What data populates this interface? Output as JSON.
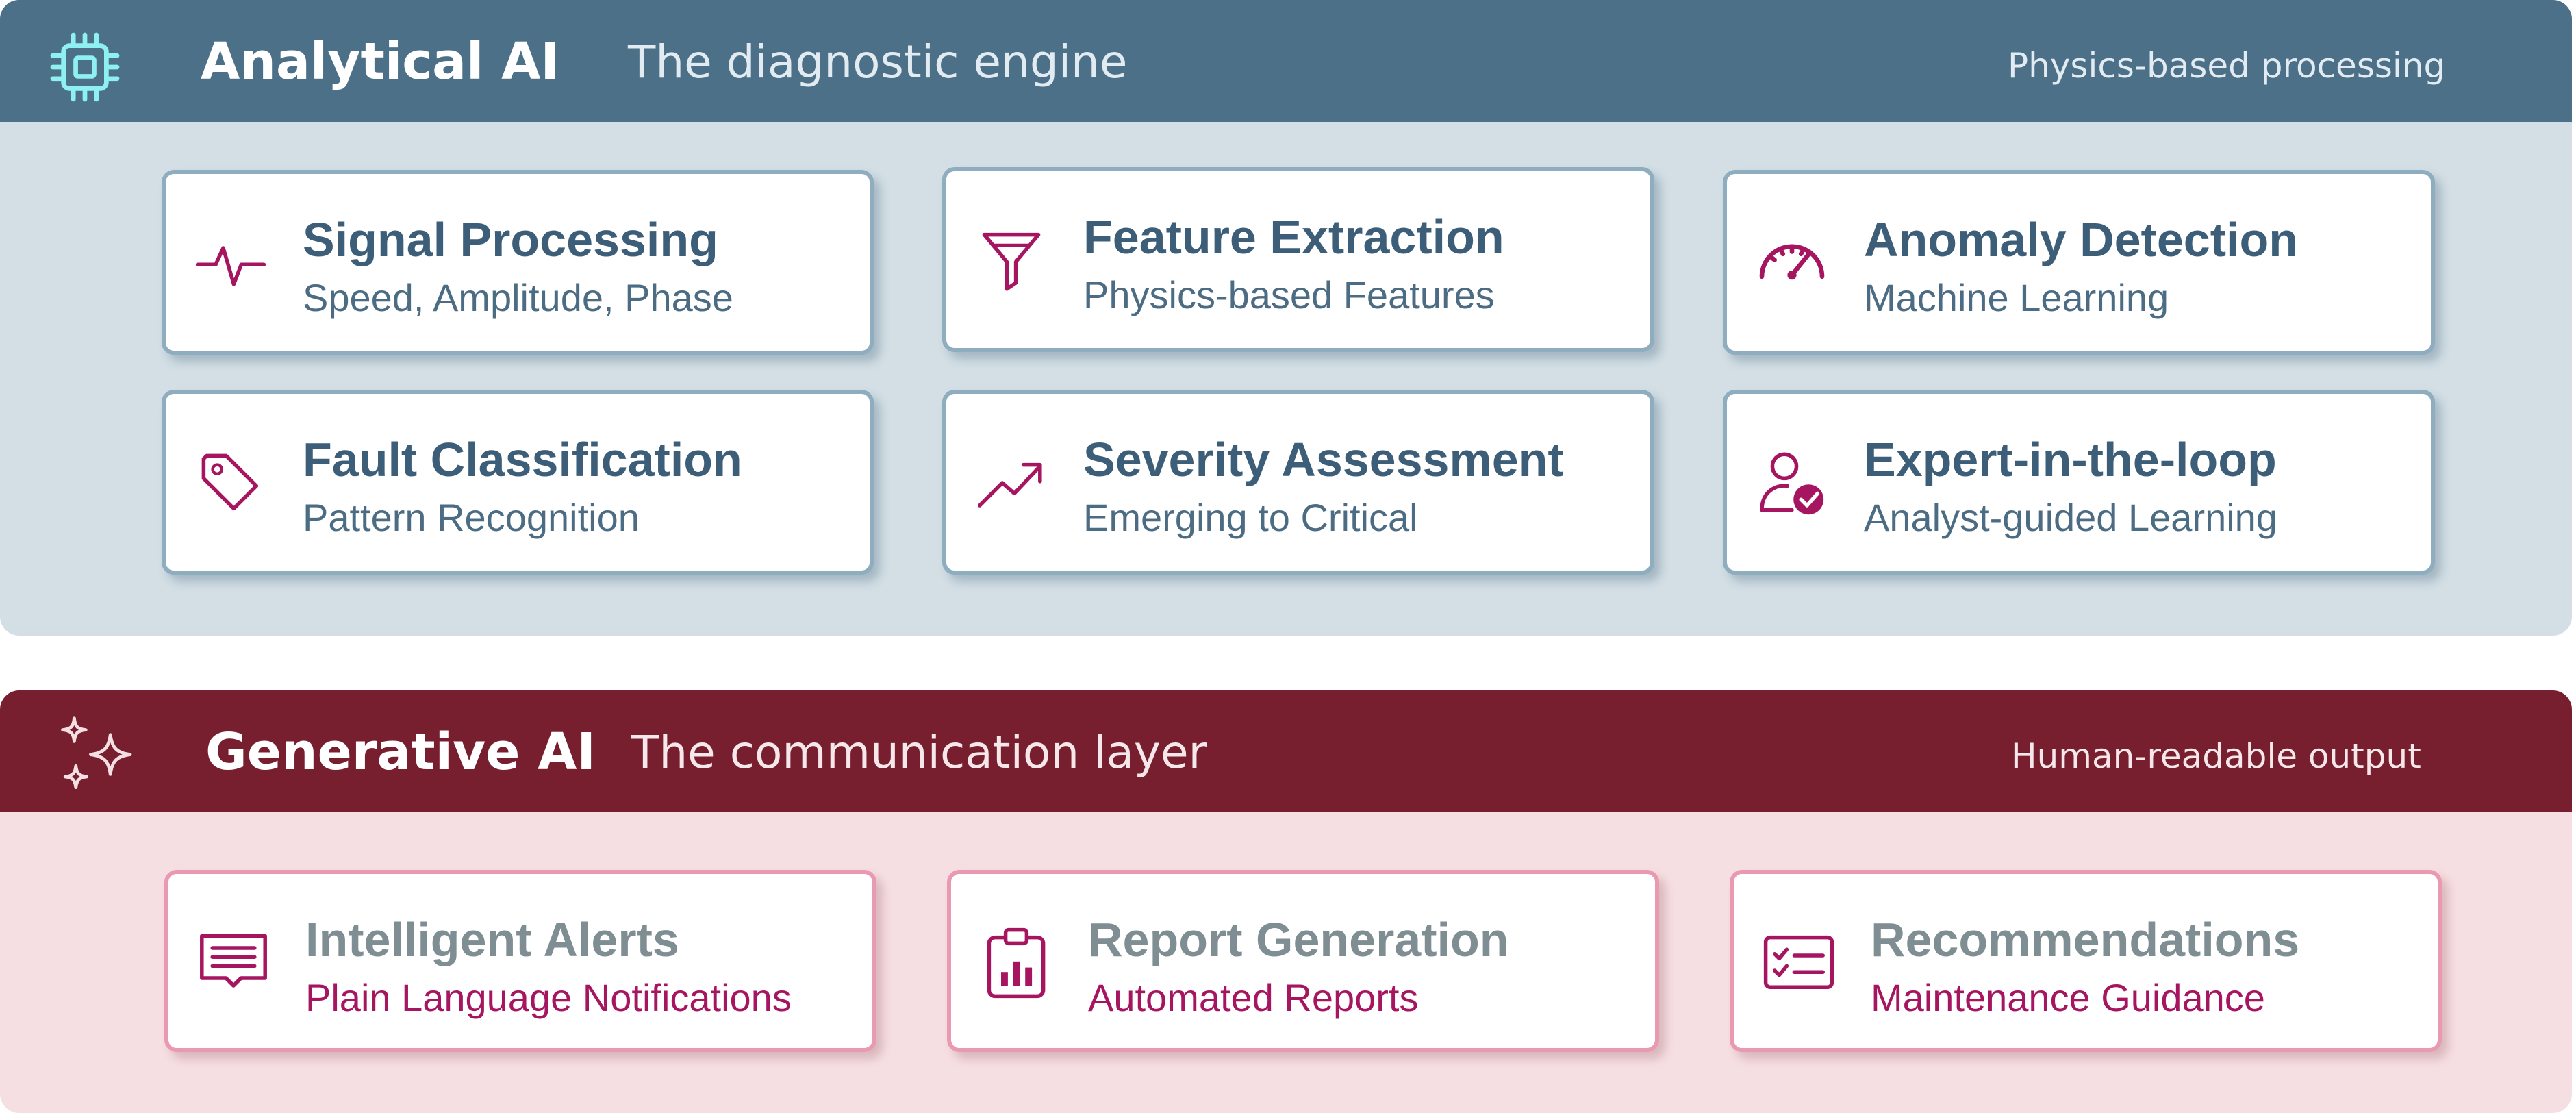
{
  "colors": {
    "analytical_band": "#4b7088",
    "analytical_panel": "#d3dfe5",
    "generative_band": "#771f2f",
    "generative_panel": "#f6dfe2",
    "accent_magenta": "#a6155f",
    "icon_cyan": "#8ff0f2"
  },
  "analytical": {
    "icon": "chip-icon",
    "title": "Analytical AI",
    "subtitle": "The diagnostic engine",
    "tag": "Physics-based processing",
    "cards": [
      {
        "icon": "pulse-icon",
        "title": "Signal Processing",
        "subtitle": "Speed, Amplitude, Phase"
      },
      {
        "icon": "funnel-icon",
        "title": "Feature Extraction",
        "subtitle": "Physics-based Features"
      },
      {
        "icon": "gauge-icon",
        "title": "Anomaly Detection",
        "subtitle": "Machine Learning"
      },
      {
        "icon": "tag-icon",
        "title": "Fault Classification",
        "subtitle": "Pattern Recognition"
      },
      {
        "icon": "trend-up-icon",
        "title": "Severity Assessment",
        "subtitle": "Emerging to Critical"
      },
      {
        "icon": "user-check-icon",
        "title": "Expert-in-the-loop",
        "subtitle": "Analyst-guided Learning"
      }
    ]
  },
  "generative": {
    "icon": "sparkles-icon",
    "title": "Generative AI",
    "subtitle": "The communication layer",
    "tag": "Human-readable output",
    "cards": [
      {
        "icon": "message-alert-icon",
        "title": "Intelligent Alerts",
        "subtitle": "Plain Language Notifications"
      },
      {
        "icon": "clipboard-chart-icon",
        "title": "Report Generation",
        "subtitle": "Automated Reports"
      },
      {
        "icon": "checklist-icon",
        "title": "Recommendations",
        "subtitle": "Maintenance Guidance"
      }
    ]
  }
}
